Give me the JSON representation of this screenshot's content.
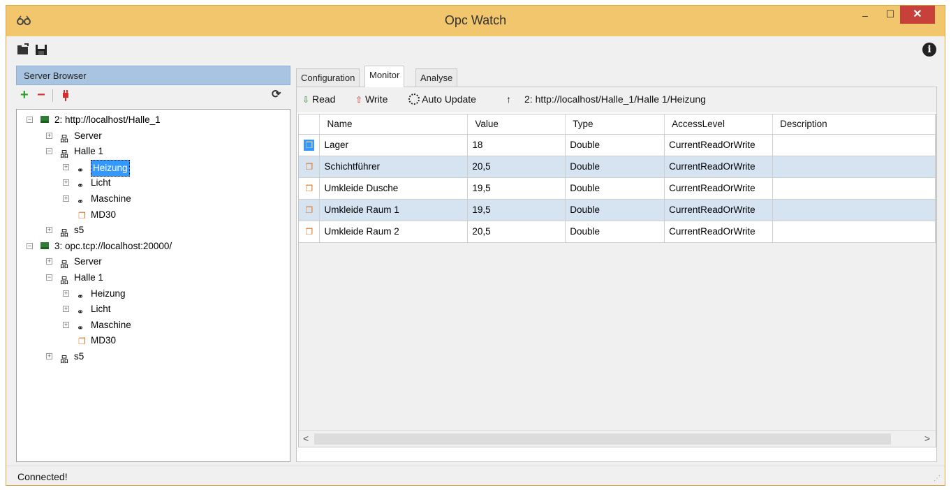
{
  "window": {
    "title": "Opc Watch",
    "minimize": "–",
    "maximize": "☐",
    "close": "✕"
  },
  "toolbar": {
    "open_icon": "open-folder-icon",
    "save_icon": "save-disk-icon",
    "info_icon": "info-icon",
    "info_glyph": "i"
  },
  "server_browser": {
    "header": "Server Browser",
    "tools": {
      "add": "+",
      "remove": "−",
      "connect": "plug-icon",
      "refresh": "⟳"
    },
    "tree": [
      {
        "label": "2: http://localhost/Halle_1",
        "depth": 0,
        "expand": "⊟",
        "kind": "server"
      },
      {
        "label": "Server",
        "depth": 1,
        "expand": "⊞",
        "kind": "folder"
      },
      {
        "label": "Halle 1",
        "depth": 1,
        "expand": "⊟",
        "kind": "folder"
      },
      {
        "label": "Heizung",
        "depth": 2,
        "expand": "⊞",
        "kind": "object",
        "selected": true
      },
      {
        "label": "Licht",
        "depth": 2,
        "expand": "⊞",
        "kind": "object"
      },
      {
        "label": "Maschine",
        "depth": 2,
        "expand": "⊞",
        "kind": "object"
      },
      {
        "label": "MD30",
        "depth": 3,
        "expand": "",
        "kind": "variable"
      },
      {
        "label": "s5",
        "depth": 1,
        "expand": "⊞",
        "kind": "folder"
      },
      {
        "label": "3: opc.tcp://localhost:20000/",
        "depth": 0,
        "expand": "⊟",
        "kind": "server"
      },
      {
        "label": "Server",
        "depth": 1,
        "expand": "⊞",
        "kind": "folder"
      },
      {
        "label": "Halle 1",
        "depth": 1,
        "expand": "⊟",
        "kind": "folder"
      },
      {
        "label": "Heizung",
        "depth": 2,
        "expand": "⊞",
        "kind": "object"
      },
      {
        "label": "Licht",
        "depth": 2,
        "expand": "⊞",
        "kind": "object"
      },
      {
        "label": "Maschine",
        "depth": 2,
        "expand": "⊞",
        "kind": "object"
      },
      {
        "label": "MD30",
        "depth": 3,
        "expand": "",
        "kind": "variable"
      },
      {
        "label": "s5",
        "depth": 1,
        "expand": "⊞",
        "kind": "folder"
      }
    ]
  },
  "tabs": [
    {
      "label": "Configuration"
    },
    {
      "label": "Monitor",
      "active": true
    },
    {
      "label": "Analyse"
    }
  ],
  "monitor": {
    "read_label": "Read",
    "write_label": "Write",
    "auto_update_label": "Auto Update",
    "up_glyph": "↑",
    "path": "2: http://localhost/Halle_1/Halle 1/Heizung",
    "columns": [
      "Name",
      "Value",
      "Type",
      "AccessLevel",
      "Description"
    ],
    "rows": [
      {
        "name": "Lager",
        "value": "18",
        "type": "Double",
        "access": "CurrentReadOrWrite",
        "description": ""
      },
      {
        "name": "Schichtführer",
        "value": "20,5",
        "type": "Double",
        "access": "CurrentReadOrWrite",
        "description": ""
      },
      {
        "name": "Umkleide Dusche",
        "value": "19,5",
        "type": "Double",
        "access": "CurrentReadOrWrite",
        "description": ""
      },
      {
        "name": "Umkleide Raum 1",
        "value": "19,5",
        "type": "Double",
        "access": "CurrentReadOrWrite",
        "description": ""
      },
      {
        "name": "Umkleide Raum 2",
        "value": "20,5",
        "type": "Double",
        "access": "CurrentReadOrWrite",
        "description": ""
      }
    ],
    "scroll_left": "<",
    "scroll_right": ">"
  },
  "status": {
    "text": "Connected!"
  },
  "colors": {
    "titlebar": "#f2c66d",
    "close": "#c7403a",
    "header": "#a9c4e0",
    "row_alt": "#d6e4f1",
    "selection": "#3399ff"
  }
}
